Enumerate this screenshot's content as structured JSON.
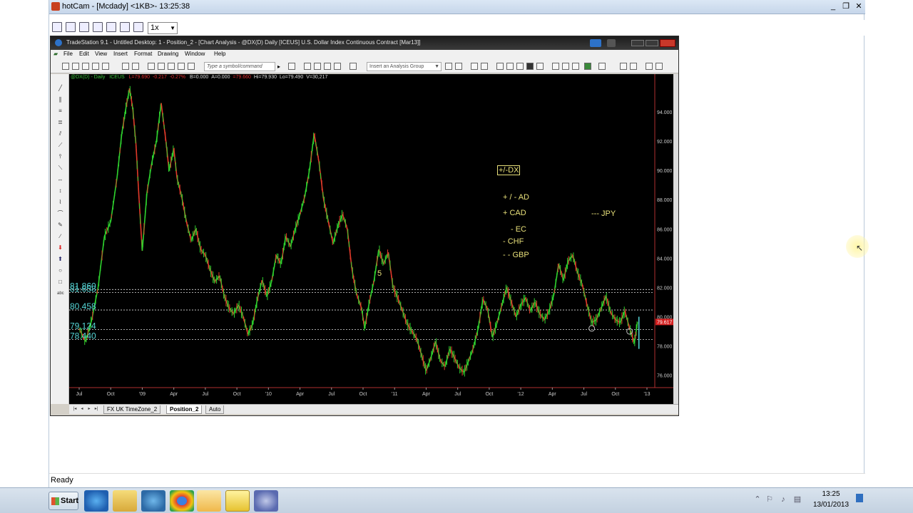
{
  "hotcam": {
    "title": "hotCam - [Mcdady] <1KB>- 13:25:38",
    "zoom": "1x",
    "status": "Ready",
    "min_label": "_",
    "max_label": "❐",
    "close_label": "✕"
  },
  "tradestation": {
    "title": "TradeStation 9.1 - Untitled Desktop: 1 - Position_2 - [Chart Analysis - @DX(D) Daily [ICEUS] U.S. Dollar Index Continuous Contract [Mar13]]",
    "menu": [
      "File",
      "Edit",
      "View",
      "Insert",
      "Format",
      "Drawing",
      "Window",
      "Help"
    ],
    "symbol_placeholder": "Type a symbol/command",
    "analysis_group": "Insert an Analysis Group",
    "tabs": [
      "FX UK TimeZone_2",
      "Position_2",
      "Auto"
    ],
    "active_tab": "Position_2"
  },
  "chart_data": {
    "type": "line",
    "symbol_line": {
      "symbol": "@DX(D) - Daily",
      "exchange": "ICEUS",
      "last": "L=79.690",
      "change": "-0.217",
      "change_pct": "-0.27%",
      "bid": "B=0.000",
      "ask": "A=0.000",
      "price": "=79.660",
      "high": "Hi=79.930",
      "low": "Lo=79.490",
      "volume": "V=30,217"
    },
    "y_ticks": [
      "94.000",
      "92.000",
      "90.000",
      "88.000",
      "86.000",
      "84.000",
      "82.000",
      "80.000",
      "78.000",
      "76.000"
    ],
    "ylim": [
      75.3,
      95.9
    ],
    "current_price_label": "79.617",
    "current_price": 79.617,
    "x_ticks": [
      "Jul",
      "Oct",
      "'09",
      "Apr",
      "Jul",
      "Oct",
      "'10",
      "Apr",
      "Jul",
      "Oct",
      "'11",
      "Apr",
      "Jul",
      "Oct",
      "'12",
      "Apr",
      "Jul",
      "Oct",
      "'13"
    ],
    "x_tick_index": [
      0,
      1,
      2,
      3,
      4,
      5,
      6,
      7,
      8,
      9,
      10,
      11,
      12,
      13,
      14,
      15,
      16,
      17,
      18
    ],
    "level_lines": [
      {
        "label": "81.860",
        "value": 81.86
      },
      {
        "label": "81.658",
        "value": 81.66
      },
      {
        "label": "80.458",
        "value": 80.458
      },
      {
        "label": "79.124",
        "value": 79.124
      },
      {
        "label": "78.440",
        "value": 78.44
      }
    ],
    "price_path": [
      [
        0,
        79.2
      ],
      [
        0.2,
        78.3
      ],
      [
        0.4,
        79.8
      ],
      [
        0.6,
        82.0
      ],
      [
        0.8,
        85.5
      ],
      [
        1.0,
        86.5
      ],
      [
        1.2,
        89.5
      ],
      [
        1.35,
        92.5
      ],
      [
        1.5,
        94.5
      ],
      [
        1.6,
        95.6
      ],
      [
        1.7,
        94.2
      ],
      [
        1.8,
        91.8
      ],
      [
        1.9,
        88.0
      ],
      [
        2.0,
        84.5
      ],
      [
        2.15,
        88.5
      ],
      [
        2.3,
        90.5
      ],
      [
        2.45,
        92.0
      ],
      [
        2.6,
        94.6
      ],
      [
        2.75,
        92.0
      ],
      [
        2.85,
        90.0
      ],
      [
        3.0,
        91.5
      ],
      [
        3.1,
        89.5
      ],
      [
        3.25,
        88.2
      ],
      [
        3.4,
        86.5
      ],
      [
        3.55,
        85.2
      ],
      [
        3.7,
        86.0
      ],
      [
        3.85,
        84.6
      ],
      [
        4.0,
        84.2
      ],
      [
        4.15,
        83.2
      ],
      [
        4.3,
        82.4
      ],
      [
        4.45,
        82.8
      ],
      [
        4.6,
        81.4
      ],
      [
        4.75,
        80.6
      ],
      [
        4.9,
        80.2
      ],
      [
        5.05,
        80.8
      ],
      [
        5.2,
        80.0
      ],
      [
        5.35,
        78.8
      ],
      [
        5.5,
        79.5
      ],
      [
        5.65,
        81.2
      ],
      [
        5.8,
        82.5
      ],
      [
        5.95,
        81.4
      ],
      [
        6.1,
        82.4
      ],
      [
        6.25,
        84.2
      ],
      [
        6.4,
        83.6
      ],
      [
        6.55,
        85.5
      ],
      [
        6.7,
        84.8
      ],
      [
        6.85,
        86.0
      ],
      [
        7.0,
        87.0
      ],
      [
        7.15,
        88.2
      ],
      [
        7.3,
        90.0
      ],
      [
        7.45,
        92.5
      ],
      [
        7.6,
        90.6
      ],
      [
        7.75,
        88.0
      ],
      [
        7.9,
        86.5
      ],
      [
        8.05,
        85.0
      ],
      [
        8.2,
        86.2
      ],
      [
        8.35,
        87.0
      ],
      [
        8.5,
        86.0
      ],
      [
        8.65,
        83.2
      ],
      [
        8.8,
        81.5
      ],
      [
        8.95,
        80.6
      ],
      [
        9.05,
        79.2
      ],
      [
        9.2,
        81.0
      ],
      [
        9.35,
        82.5
      ],
      [
        9.5,
        84.6
      ],
      [
        9.65,
        83.6
      ],
      [
        9.8,
        84.4
      ],
      [
        9.95,
        82.0
      ],
      [
        10.1,
        81.3
      ],
      [
        10.25,
        80.4
      ],
      [
        10.4,
        79.5
      ],
      [
        10.55,
        79.0
      ],
      [
        10.7,
        78.5
      ],
      [
        10.85,
        77.4
      ],
      [
        11.0,
        76.3
      ],
      [
        11.15,
        77.2
      ],
      [
        11.3,
        78.3
      ],
      [
        11.45,
        77.0
      ],
      [
        11.6,
        76.6
      ],
      [
        11.75,
        77.8
      ],
      [
        11.9,
        77.2
      ],
      [
        12.05,
        76.5
      ],
      [
        12.2,
        76.2
      ],
      [
        12.35,
        77.0
      ],
      [
        12.5,
        77.9
      ],
      [
        12.65,
        79.2
      ],
      [
        12.8,
        81.2
      ],
      [
        12.95,
        80.5
      ],
      [
        13.1,
        78.6
      ],
      [
        13.25,
        79.6
      ],
      [
        13.4,
        80.8
      ],
      [
        13.55,
        82.0
      ],
      [
        13.7,
        81.0
      ],
      [
        13.85,
        80.0
      ],
      [
        14.0,
        80.8
      ],
      [
        14.15,
        81.3
      ],
      [
        14.3,
        80.4
      ],
      [
        14.45,
        81.0
      ],
      [
        14.6,
        80.2
      ],
      [
        14.75,
        79.8
      ],
      [
        14.9,
        80.4
      ],
      [
        15.05,
        81.5
      ],
      [
        15.2,
        83.6
      ],
      [
        15.35,
        82.5
      ],
      [
        15.5,
        83.8
      ],
      [
        15.65,
        84.2
      ],
      [
        15.8,
        83.0
      ],
      [
        15.95,
        82.2
      ],
      [
        16.1,
        80.8
      ],
      [
        16.25,
        79.6
      ],
      [
        16.4,
        79.8
      ],
      [
        16.55,
        80.6
      ],
      [
        16.7,
        81.4
      ],
      [
        16.85,
        80.3
      ],
      [
        17.0,
        79.8
      ],
      [
        17.15,
        79.6
      ],
      [
        17.3,
        80.4
      ],
      [
        17.45,
        79.2
      ],
      [
        17.6,
        78.2
      ],
      [
        17.7,
        79.62
      ]
    ],
    "annotations": {
      "box_label": "+/-DX",
      "lines": [
        "+ / - AD",
        "+ CAD",
        "- EC",
        "- CHF",
        "- - GBP"
      ],
      "jpy": "--- JPY",
      "wave_label": "5"
    }
  },
  "taskbar": {
    "start": "Start",
    "time": "13:25",
    "date": "13/01/2013"
  }
}
